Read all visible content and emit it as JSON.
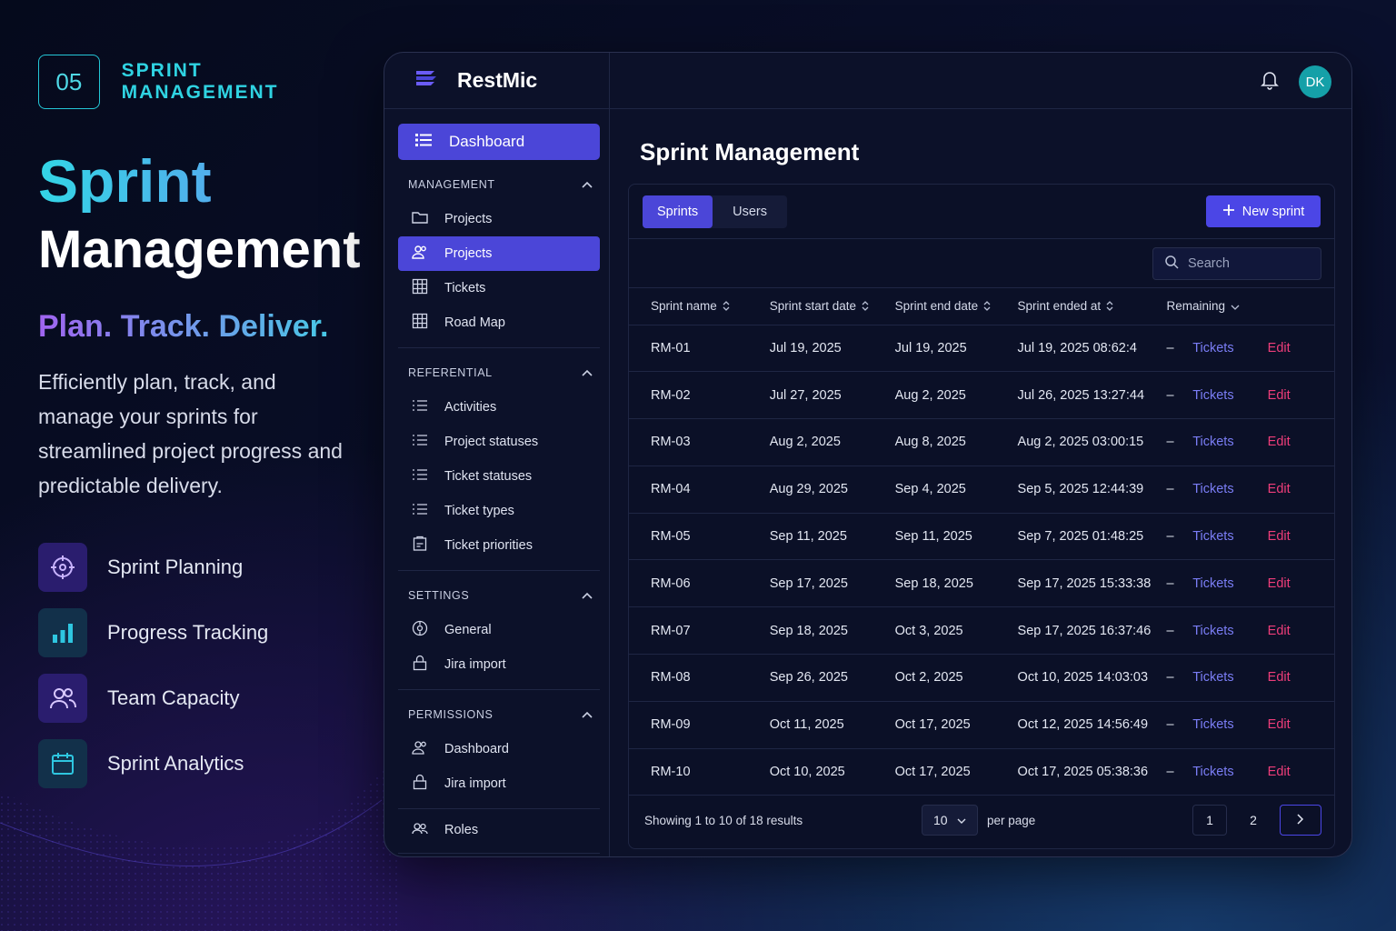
{
  "promo": {
    "number": "05",
    "kicker": "SPRINT MANAGEMENT",
    "title_line1": "Sprint",
    "title_line2": "Management",
    "tagline": "Plan. Track. Deliver.",
    "description": "Efficiently plan, track, and manage your sprints for streamlined project progress and predictable delivery.",
    "features": [
      {
        "label": "Sprint Planning",
        "icon": "target-icon",
        "color": "#9a63f0"
      },
      {
        "label": "Progress Tracking",
        "icon": "bar-chart-icon",
        "color": "#2ec6e0"
      },
      {
        "label": "Team Capacity",
        "icon": "users-icon",
        "color": "#a373f5"
      },
      {
        "label": "Sprint Analytics",
        "icon": "calendar-icon",
        "color": "#2ec6e0"
      }
    ]
  },
  "app": {
    "brand": "RestMic",
    "avatar_initials": "DK",
    "accent": "#4b46d8",
    "sidebar": {
      "dashboard": "Dashboard",
      "sections": {
        "management": {
          "title": "MANAGEMENT",
          "items": [
            "Projects",
            "Projects",
            "Tickets",
            "Road Map"
          ]
        },
        "referential": {
          "title": "REFERENTIAL",
          "items": [
            "Activities",
            "Project statuses",
            "Ticket statuses",
            "Ticket types",
            "Ticket priorities"
          ]
        },
        "settings": {
          "title": "SETTINGS",
          "items": [
            "General",
            "Jira import"
          ]
        },
        "permissions": {
          "title": "PERMISSIONS",
          "items": [
            "Dashboard",
            "Jira import"
          ]
        },
        "roles": "Roles"
      }
    },
    "main": {
      "title": "Sprint Management",
      "tabs": [
        "Sprints",
        "Users"
      ],
      "new_button": "New sprint",
      "search_placeholder": "Search",
      "columns": [
        "Sprint name",
        "Sprint start date",
        "Sprint end date",
        "Sprint ended at",
        "Remaining"
      ],
      "rows": [
        {
          "name": "RM-01",
          "start": "Jul 19, 2025",
          "end": "Jul 19, 2025",
          "ended": "Jul 19, 2025 08:62:4",
          "remaining": "–",
          "tickets": "Tickets",
          "edit": "Edit"
        },
        {
          "name": "RM-02",
          "start": "Jul 27, 2025",
          "end": "Aug 2, 2025",
          "ended": "Jul 26, 2025 13:27:44",
          "remaining": "–",
          "tickets": "Tickets",
          "edit": "Edit"
        },
        {
          "name": "RM-03",
          "start": "Aug 2, 2025",
          "end": "Aug 8, 2025",
          "ended": "Aug 2, 2025 03:00:15",
          "remaining": "–",
          "tickets": "Tickets",
          "edit": "Edit"
        },
        {
          "name": "RM-04",
          "start": "Aug 29, 2025",
          "end": "Sep 4, 2025",
          "ended": "Sep 5, 2025 12:44:39",
          "remaining": "–",
          "tickets": "Tickets",
          "edit": "Edit"
        },
        {
          "name": "RM-05",
          "start": "Sep 11, 2025",
          "end": "Sep 11, 2025",
          "ended": "Sep 7, 2025 01:48:25",
          "remaining": "–",
          "tickets": "Tickets",
          "edit": "Edit"
        },
        {
          "name": "RM-06",
          "start": "Sep 17, 2025",
          "end": "Sep 18, 2025",
          "ended": "Sep 17, 2025 15:33:38",
          "remaining": "–",
          "tickets": "Tickets",
          "edit": "Edit"
        },
        {
          "name": "RM-07",
          "start": "Sep 18, 2025",
          "end": "Oct 3, 2025",
          "ended": "Sep 17, 2025 16:37:46",
          "remaining": "–",
          "tickets": "Tickets",
          "edit": "Edit"
        },
        {
          "name": "RM-08",
          "start": "Sep 26, 2025",
          "end": "Oct 2, 2025",
          "ended": "Oct 10, 2025 14:03:03",
          "remaining": "–",
          "tickets": "Tickets",
          "edit": "Edit"
        },
        {
          "name": "RM-09",
          "start": "Oct 11, 2025",
          "end": "Oct 17, 2025",
          "ended": "Oct 12, 2025 14:56:49",
          "remaining": "–",
          "tickets": "Tickets",
          "edit": "Edit"
        },
        {
          "name": "RM-10",
          "start": "Oct 10, 2025",
          "end": "Oct 17, 2025",
          "ended": "Oct 17, 2025 05:38:36",
          "remaining": "–",
          "tickets": "Tickets",
          "edit": "Edit"
        }
      ],
      "footer": {
        "showing": "Showing 1 to 10 of 18 results",
        "per_page_value": "10",
        "per_page_label": "per page",
        "pages": [
          "1",
          "2"
        ]
      }
    }
  }
}
